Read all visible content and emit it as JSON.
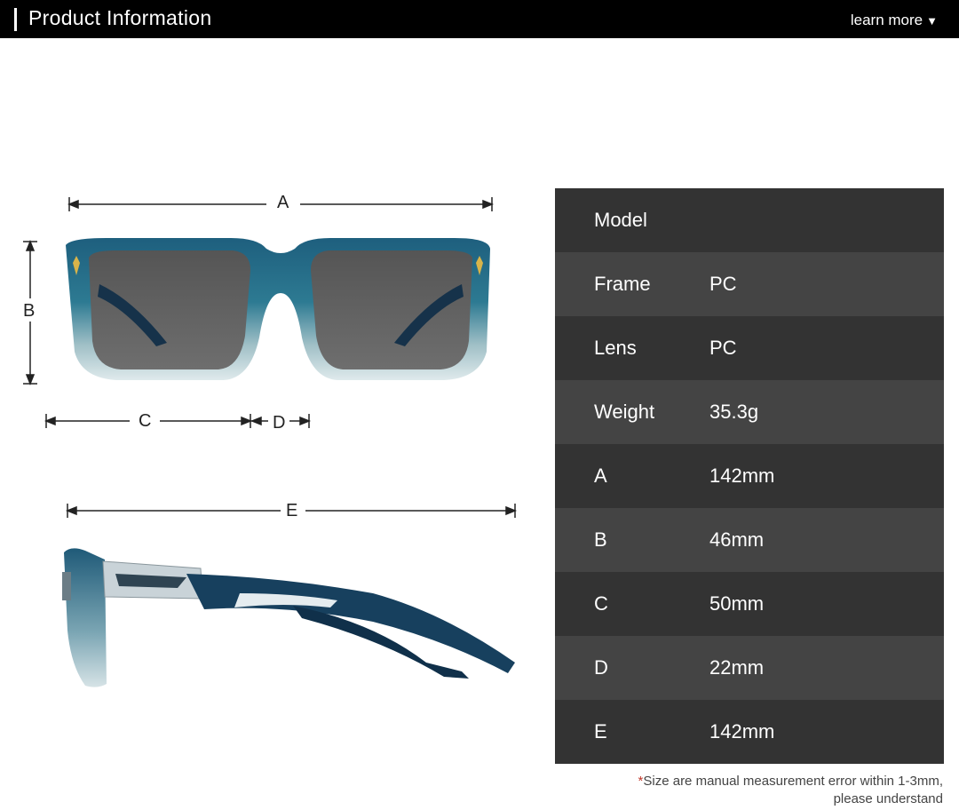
{
  "header": {
    "title": "Product Information",
    "learn_more": "learn more"
  },
  "diagram": {
    "label_a": "A",
    "label_b": "B",
    "label_c": "C",
    "label_d": "D",
    "label_e": "E"
  },
  "specs": [
    {
      "key": "Model",
      "value": ""
    },
    {
      "key": "Frame",
      "value": "PC"
    },
    {
      "key": "Lens",
      "value": "PC"
    },
    {
      "key": "Weight",
      "value": "35.3g"
    },
    {
      "key": "A",
      "value": "142mm"
    },
    {
      "key": "B",
      "value": "46mm"
    },
    {
      "key": "C",
      "value": "50mm"
    },
    {
      "key": "D",
      "value": "22mm"
    },
    {
      "key": "E",
      "value": "142mm"
    }
  ],
  "note": {
    "asterisk": "*",
    "line1": "Size are manual measurement error within 1-3mm,",
    "line2": "please understand"
  },
  "colors": {
    "row_dark": "#333333",
    "row_light": "#444444",
    "frame_blue": "#1f5a78"
  }
}
